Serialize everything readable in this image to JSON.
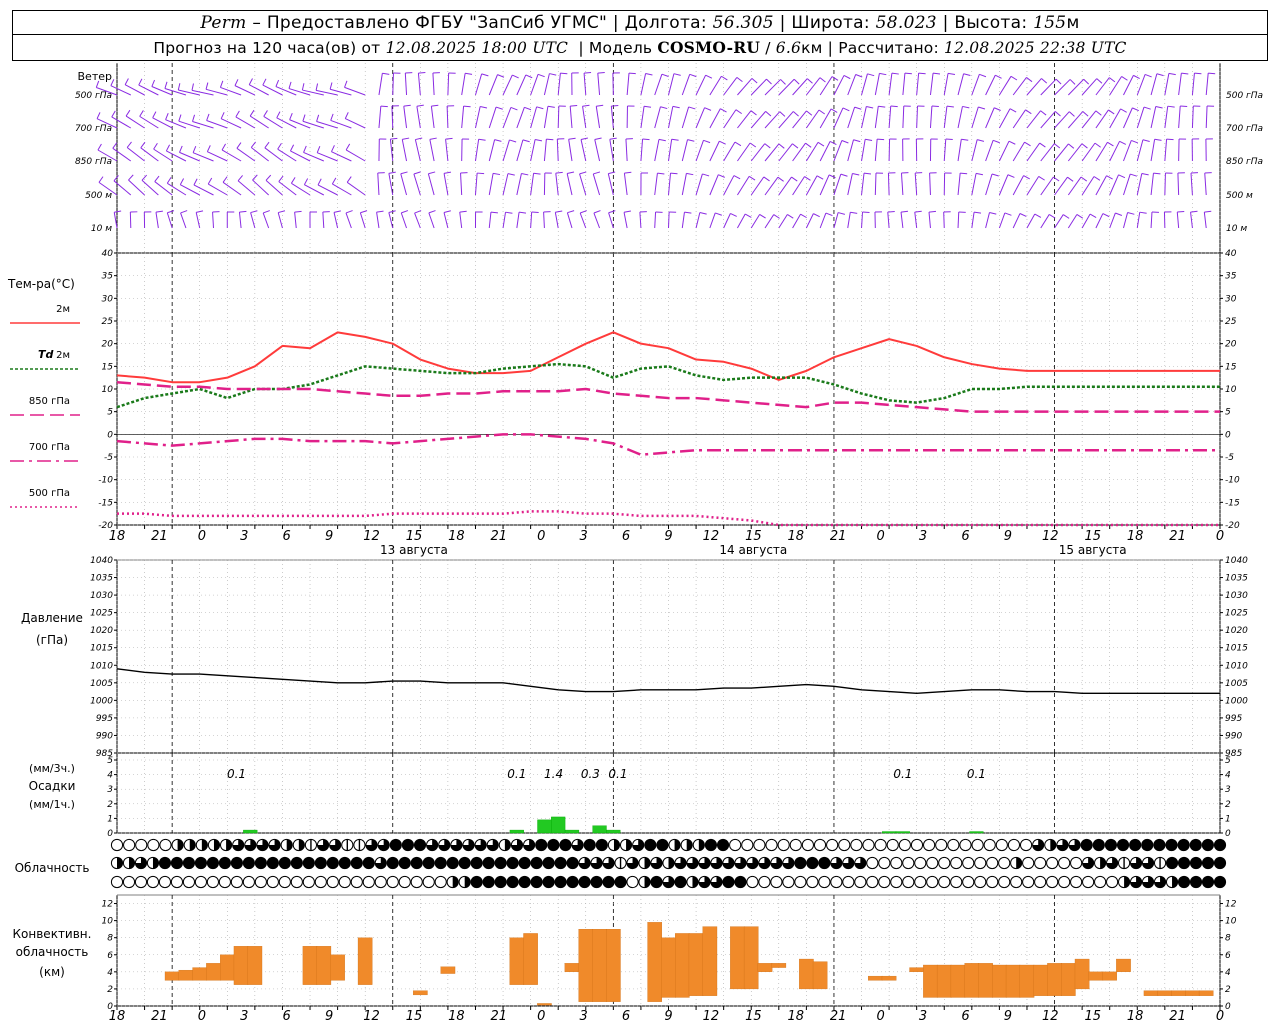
{
  "header": {
    "station": "Perm",
    "provider_text": "– Предоставлено ФГБУ \"ЗапСиб УГМС\"",
    "lon_label": "Долгота:",
    "lon_value": "56.305",
    "lat_label": "Широта:",
    "lat_value": "58.023",
    "alt_label": "Высота:",
    "alt_value": "155",
    "alt_unit": "м",
    "forecast_label": "Прогноз на 120 часа(ов) от",
    "forecast_time": "12.08.2025 18:00 UTC",
    "model_label": "Модель",
    "model_name": "COSMO-RU",
    "model_res": "6.6",
    "model_res_unit": "км",
    "calc_label": "Рассчитано:",
    "calc_time": "12.08.2025 22:38 UTC"
  },
  "colors": {
    "wind": "#8a2be2",
    "t2m": "#ff3b3b",
    "td2m": "#1a7a1a",
    "t850": "#e0208a",
    "t700": "#e0208a",
    "t500": "#e0208a",
    "pressure": "#000000",
    "precip": "#22c922",
    "convective": "#f08a2a"
  },
  "wind_panel": {
    "title": "Ветер",
    "levels": [
      "500 гПа",
      "700 гПа",
      "850 гПа",
      "500 м",
      "10  м"
    ]
  },
  "temp_panel": {
    "title": "Тем-ра(°С)",
    "legend": [
      {
        "label": "2м",
        "prefix": ""
      },
      {
        "label": "2м",
        "prefix": "Td"
      },
      {
        "label": "850 гПа",
        "prefix": ""
      },
      {
        "label": "700 гПа",
        "prefix": ""
      },
      {
        "label": "500 гПа",
        "prefix": ""
      }
    ]
  },
  "pressure_panel": {
    "title_line1": "Давление",
    "title_line2": "(гПа)"
  },
  "precip_panel": {
    "label_line1": "(мм/3ч.)",
    "label_line2": "Осадки",
    "label_line3": "(мм/1ч.)"
  },
  "cloud_panel": {
    "title": "Облачность"
  },
  "conv_panel": {
    "title_line1": "Конвективн.",
    "title_line2": "облачность",
    "title_line3": "(км)"
  },
  "time_axis": {
    "hour_labels": [
      "18",
      "21",
      "0",
      "3",
      "6",
      "9",
      "12",
      "15",
      "18",
      "21",
      "0",
      "3",
      "6",
      "9",
      "12",
      "15",
      "18",
      "21",
      "0",
      "3",
      "6",
      "9",
      "12",
      "15",
      "18",
      "21",
      "0"
    ],
    "date_labels": [
      "13 августа",
      "14 августа",
      "15 августа"
    ]
  },
  "chart_data": [
    {
      "type": "line",
      "panel": "temperature",
      "x_hours": [
        0,
        3,
        6,
        9,
        12,
        15,
        18,
        21,
        24,
        27,
        30,
        33,
        36,
        39,
        42,
        45,
        48,
        51,
        54,
        57,
        60,
        63,
        66,
        69,
        72,
        75,
        78,
        81,
        84,
        87,
        90,
        93,
        96,
        99,
        102,
        105,
        108,
        111,
        114,
        117,
        120
      ],
      "ylim": [
        -20,
        40
      ],
      "yticks": [
        -20,
        -15,
        -10,
        -5,
        0,
        5,
        10,
        15,
        20,
        25,
        30,
        35,
        40
      ],
      "series": [
        {
          "name": "2м",
          "values": [
            13,
            12.5,
            11.5,
            11.5,
            12.5,
            15,
            19.5,
            19,
            22.5,
            21.5,
            20,
            16.5,
            14.5,
            13.5,
            13.5,
            14,
            17,
            20,
            22.5,
            20,
            19,
            16.5,
            16,
            14.5,
            12,
            14,
            17,
            19,
            21,
            19.5,
            17,
            15.5,
            14.5,
            14,
            14,
            14,
            14,
            14,
            14,
            14,
            14
          ]
        },
        {
          "name": "Td 2м",
          "values": [
            6,
            8,
            9,
            10,
            8,
            10,
            10,
            11,
            13,
            15,
            14.5,
            14,
            13.5,
            13.5,
            14.5,
            15,
            15.5,
            15,
            12.5,
            14.5,
            15,
            13,
            12,
            12.5,
            12.5,
            12.5,
            11,
            9,
            7.5,
            7,
            8,
            10,
            10,
            10.5,
            10.5,
            10.5,
            10.5,
            10.5,
            10.5,
            10.5,
            10.5
          ]
        },
        {
          "name": "850 гПа",
          "values": [
            11.5,
            11,
            10.5,
            10.5,
            10,
            10,
            10,
            10,
            9.5,
            9,
            8.5,
            8.5,
            9,
            9,
            9.5,
            9.5,
            9.5,
            10,
            9,
            8.5,
            8,
            8,
            7.5,
            7,
            6.5,
            6,
            7,
            7,
            6.5,
            6,
            5.5,
            5,
            5,
            5,
            5,
            5,
            5,
            5,
            5,
            5,
            5
          ]
        },
        {
          "name": "700 гПа",
          "values": [
            -1.5,
            -2,
            -2.5,
            -2,
            -1.5,
            -1,
            -1,
            -1.5,
            -1.5,
            -1.5,
            -2,
            -1.5,
            -1,
            -0.5,
            0,
            0,
            -0.5,
            -1,
            -2,
            -4.5,
            -4,
            -3.5,
            -3.5,
            -3.5,
            -3.5,
            -3.5,
            -3.5,
            -3.5,
            -3.5,
            -3.5,
            -3.5,
            -3.5,
            -3.5,
            -3.5,
            -3.5,
            -3.5,
            -3.5,
            -3.5,
            -3.5,
            -3.5,
            -3.5
          ]
        },
        {
          "name": "500 гПа",
          "values": [
            -17.5,
            -17.5,
            -18,
            -18,
            -18,
            -18,
            -18,
            -18,
            -18,
            -18,
            -17.5,
            -17.5,
            -17.5,
            -17.5,
            -17.5,
            -17,
            -17,
            -17.5,
            -17.5,
            -18,
            -18,
            -18,
            -18.5,
            -19,
            -20,
            -20,
            -20,
            -20,
            -20,
            -20,
            -20,
            -20,
            -20,
            -20,
            -20,
            -20,
            -20,
            -20,
            -20,
            -20,
            -20
          ]
        }
      ]
    },
    {
      "type": "line",
      "panel": "pressure",
      "x_hours": [
        0,
        3,
        6,
        9,
        12,
        15,
        18,
        21,
        24,
        27,
        30,
        33,
        36,
        39,
        42,
        45,
        48,
        51,
        54,
        57,
        60,
        63,
        66,
        69,
        72,
        75,
        78,
        81,
        84,
        87,
        90,
        93,
        96,
        99,
        102,
        105,
        108,
        111,
        114,
        117,
        120
      ],
      "ylim": [
        985,
        1040
      ],
      "yticks": [
        985,
        990,
        995,
        1000,
        1005,
        1010,
        1015,
        1020,
        1025,
        1030,
        1035,
        1040
      ],
      "series": [
        {
          "name": "Давление",
          "values": [
            1009,
            1008,
            1007.5,
            1007.5,
            1007,
            1006.5,
            1006,
            1005.5,
            1005,
            1005,
            1005.5,
            1005.5,
            1005,
            1005,
            1005,
            1004,
            1003,
            1002.5,
            1002.5,
            1003,
            1003,
            1003,
            1003.5,
            1003.5,
            1004,
            1004.5,
            1004,
            1003,
            1002.5,
            1002,
            1002.5,
            1003,
            1003,
            1002.5,
            1002.5,
            1002,
            1002,
            1002,
            1002,
            1002,
            1002
          ]
        }
      ]
    },
    {
      "type": "bar",
      "panel": "precipitation",
      "ylim": [
        0,
        5
      ],
      "yticks": [
        0,
        1,
        2,
        3,
        4,
        5
      ],
      "bars": [
        {
          "hour": 14.5,
          "value": 0.2
        },
        {
          "hour": 43.5,
          "value": 0.2
        },
        {
          "hour": 46.5,
          "value": 0.9
        },
        {
          "hour": 48,
          "value": 1.1
        },
        {
          "hour": 49.5,
          "value": 0.2
        },
        {
          "hour": 52.5,
          "value": 0.5
        },
        {
          "hour": 54,
          "value": 0.2
        },
        {
          "hour": 84,
          "value": 0.1
        },
        {
          "hour": 85.5,
          "value": 0.1
        },
        {
          "hour": 93.5,
          "value": 0.1
        }
      ],
      "labels": [
        {
          "hour": 13,
          "text": "0.1"
        },
        {
          "hour": 43.5,
          "text": "0.1"
        },
        {
          "hour": 47.5,
          "text": "1.4"
        },
        {
          "hour": 51.5,
          "text": "0.3"
        },
        {
          "hour": 54.5,
          "text": "0.1"
        },
        {
          "hour": 85.5,
          "text": "0.1"
        },
        {
          "hour": 93.5,
          "text": "0.1"
        }
      ]
    },
    {
      "type": "bar",
      "panel": "convective_cloud",
      "ylim": [
        0,
        13
      ],
      "yticks": [
        0,
        2,
        4,
        6,
        8,
        10,
        12
      ],
      "bars": [
        {
          "hour": 6,
          "bottom": 3,
          "top": 4
        },
        {
          "hour": 7.5,
          "bottom": 3,
          "top": 4.2
        },
        {
          "hour": 9,
          "bottom": 3,
          "top": 4.5
        },
        {
          "hour": 10.5,
          "bottom": 3,
          "top": 5
        },
        {
          "hour": 12,
          "bottom": 3,
          "top": 6
        },
        {
          "hour": 13.5,
          "bottom": 2.5,
          "top": 7
        },
        {
          "hour": 15,
          "bottom": 2.5,
          "top": 7
        },
        {
          "hour": 21,
          "bottom": 2.5,
          "top": 7
        },
        {
          "hour": 22.5,
          "bottom": 2.5,
          "top": 7
        },
        {
          "hour": 24,
          "bottom": 3,
          "top": 6
        },
        {
          "hour": 27,
          "bottom": 2.5,
          "top": 8
        },
        {
          "hour": 33,
          "bottom": 1.3,
          "top": 1.8
        },
        {
          "hour": 36,
          "bottom": 3.8,
          "top": 4.6
        },
        {
          "hour": 43.5,
          "bottom": 2.5,
          "top": 8
        },
        {
          "hour": 45,
          "bottom": 2.5,
          "top": 8.5
        },
        {
          "hour": 46.5,
          "bottom": 0.1,
          "top": 0.3
        },
        {
          "hour": 49.5,
          "bottom": 4,
          "top": 5
        },
        {
          "hour": 51,
          "bottom": 0.5,
          "top": 9
        },
        {
          "hour": 52.5,
          "bottom": 0.5,
          "top": 9
        },
        {
          "hour": 54,
          "bottom": 0.5,
          "top": 9
        },
        {
          "hour": 58.5,
          "bottom": 0.5,
          "top": 9.8
        },
        {
          "hour": 60,
          "bottom": 1,
          "top": 8
        },
        {
          "hour": 61.5,
          "bottom": 1,
          "top": 8.5
        },
        {
          "hour": 63,
          "bottom": 1.2,
          "top": 8.5
        },
        {
          "hour": 64.5,
          "bottom": 1.2,
          "top": 9.3
        },
        {
          "hour": 67.5,
          "bottom": 2,
          "top": 9.3
        },
        {
          "hour": 69,
          "bottom": 2,
          "top": 9.3
        },
        {
          "hour": 70.5,
          "bottom": 4,
          "top": 5
        },
        {
          "hour": 72,
          "bottom": 4.5,
          "top": 5
        },
        {
          "hour": 75,
          "bottom": 2,
          "top": 5.5
        },
        {
          "hour": 76.5,
          "bottom": 2,
          "top": 5.2
        },
        {
          "hour": 82.5,
          "bottom": 3,
          "top": 3.5
        },
        {
          "hour": 84,
          "bottom": 3,
          "top": 3.5
        },
        {
          "hour": 87,
          "bottom": 4,
          "top": 4.5
        },
        {
          "hour": 88.5,
          "bottom": 1,
          "top": 4.8
        },
        {
          "hour": 90,
          "bottom": 1,
          "top": 4.8
        },
        {
          "hour": 91.5,
          "bottom": 1,
          "top": 4.8
        },
        {
          "hour": 93,
          "bottom": 1,
          "top": 5
        },
        {
          "hour": 94.5,
          "bottom": 1,
          "top": 5
        },
        {
          "hour": 96,
          "bottom": 1,
          "top": 4.8
        },
        {
          "hour": 97.5,
          "bottom": 1,
          "top": 4.8
        },
        {
          "hour": 99,
          "bottom": 1,
          "top": 4.8
        },
        {
          "hour": 100.5,
          "bottom": 1.2,
          "top": 4.8
        },
        {
          "hour": 102,
          "bottom": 1.2,
          "top": 5
        },
        {
          "hour": 103.5,
          "bottom": 1.2,
          "top": 5
        },
        {
          "hour": 105,
          "bottom": 2,
          "top": 5.5
        },
        {
          "hour": 106.5,
          "bottom": 3,
          "top": 4
        },
        {
          "hour": 108,
          "bottom": 3,
          "top": 4
        },
        {
          "hour": 109.5,
          "bottom": 4,
          "top": 5.5
        },
        {
          "hour": 112.5,
          "bottom": 1.2,
          "top": 1.8
        },
        {
          "hour": 114,
          "bottom": 1.2,
          "top": 1.8
        },
        {
          "hour": 115.5,
          "bottom": 1.2,
          "top": 1.8
        },
        {
          "hour": 117,
          "bottom": 1.2,
          "top": 1.8
        },
        {
          "hour": 118.5,
          "bottom": 1.2,
          "top": 1.8
        }
      ]
    }
  ],
  "cloud_rows": [
    "ooooohhhhhqqqqhhtqqttqqfffqqqqqqhqqfffqffhhqffhhhffoooooooooooooooooooooooooqhqqffffffffffff",
    "hhqhffffffffffffffffffqffffffffffffffffqqqtqhqhqqqqqqqqqqfffqqqoooooooooooohoooooqhqtqqtfffff",
    "oooooooooooooooooooooooooooohhfffffffffffffohfqfhqqffooooooooooooooooooooooooooooooohqqqhffff"
  ],
  "wind_rows": [
    "a",
    "b",
    "c",
    "d",
    "e"
  ]
}
